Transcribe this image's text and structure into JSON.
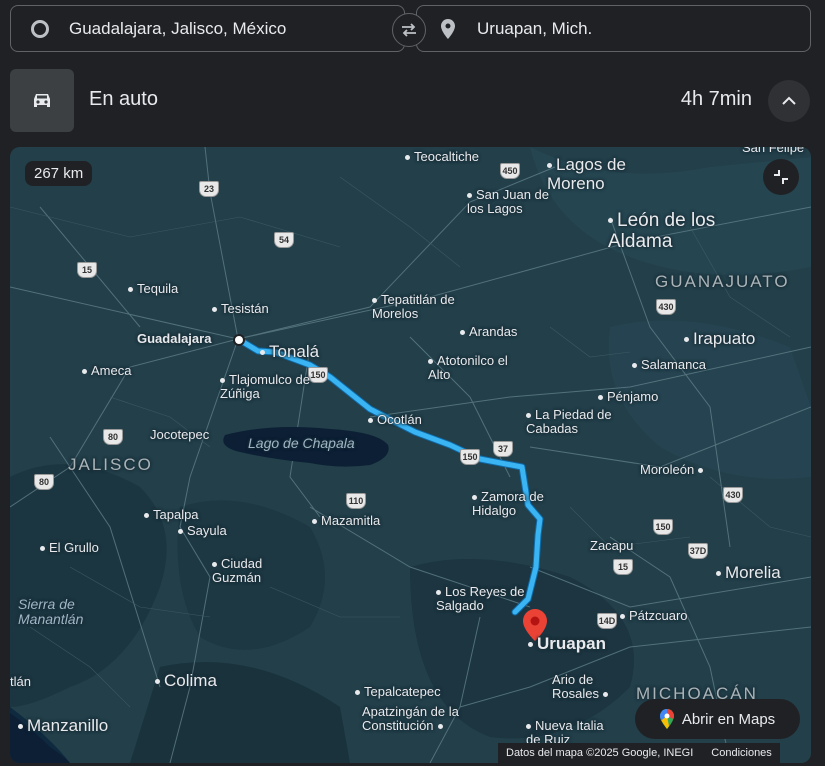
{
  "directions": {
    "origin": "Guadalajara, Jalisco, México",
    "destination": "Uruapan, Mich.",
    "mode_label": "En auto",
    "duration": "4h 7min"
  },
  "map": {
    "distance_badge": "267 km",
    "open_button_label": "Abrir en Maps",
    "attribution": "Datos del mapa ©2025 Google, INEGI",
    "terms_link": "Condiciones",
    "route_color": "#3ab4f2",
    "destination_pin_color": "#ea4335",
    "places": {
      "teocaltiche": "Teocaltiche",
      "lagos": "Lagos de Moreno",
      "san_juan": "San Juan de los Lagos",
      "leon": "León de los Aldama",
      "guanajuato": "GUANAJUATO",
      "tequila": "Tequila",
      "tesistan": "Tesistán",
      "tepatitlan": "Tepatitlán de Morelos",
      "arandas": "Arandas",
      "irapuato": "Irapuato",
      "guadalajara": "Guadalajara",
      "tonala": "Tonalá",
      "ameca": "Ameca",
      "tlajomulco": "Tlajomulco de Zúñiga",
      "atotonilco": "Atotonilco el Alto",
      "salamanca": "Salamanca",
      "penjamo": "Pénjamo",
      "ocotlan": "Ocotlán",
      "la_piedad": "La Piedad de Cabadas",
      "jocotepec": "Jocotepec",
      "chapala": "Lago de Chapala",
      "jalisco": "JALISCO",
      "moroleon": "Moroleón",
      "zamora": "Zamora de Hidalgo",
      "tapalpa": "Tapalpa",
      "sayula": "Sayula",
      "mazamitla": "Mazamitla",
      "el_grullo": "El Grullo",
      "zacapu": "Zacapu",
      "morelia": "Morelia",
      "ciudad_guzman": "Ciudad Guzmán",
      "sierra": "Sierra de Manantlán",
      "los_reyes": "Los Reyes de Salgado",
      "patzcuaro": "Pátzcuaro",
      "uruapan": "Uruapan",
      "colima": "Colima",
      "tepalcatepec": "Tepalcatepec",
      "ario": "Ario de Rosales",
      "michoacan": "MICHOACÁN",
      "manzanillo": "Manzanillo",
      "apatzingan": "Apatzingán de la Constitución",
      "nueva_italia": "Nueva Italia de Ruiz",
      "san_felipe": "San Felipe",
      "tlan": "tlán"
    },
    "shields": {
      "s23": "23",
      "s450a": "450",
      "s54": "54",
      "s15a": "15",
      "s430a": "430",
      "s150a": "150",
      "s80a": "80",
      "s37": "37",
      "s150b": "150",
      "s80b": "80",
      "s110": "110",
      "s430b": "430",
      "s150c": "150",
      "s37d": "37D",
      "s15b": "15",
      "s14d": "14D"
    }
  }
}
